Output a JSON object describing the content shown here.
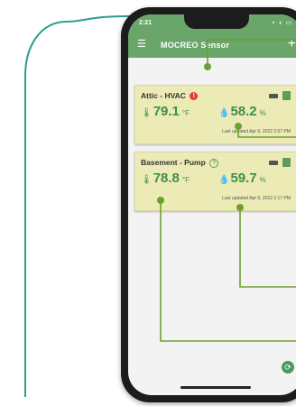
{
  "status_bar": {
    "time": "2:21",
    "system_icons": "signal wifi battery"
  },
  "app_bar": {
    "menu_icon": "menu-icon",
    "title": "MOCREO Sensor",
    "add_icon": "plus-icon"
  },
  "sensors": [
    {
      "name": "Attic - HVAC",
      "status_icon": "alert-icon",
      "status_glyph": "!",
      "temperature": "79.1",
      "temperature_unit": "°F",
      "humidity": "58.2",
      "humidity_unit": "%",
      "last_updated": "Last updated Apr 9, 2022 2:07 PM"
    },
    {
      "name": "Basement - Pump",
      "status_icon": "help-icon",
      "status_glyph": "?",
      "temperature": "78.8",
      "temperature_unit": "°F",
      "humidity": "59.7",
      "humidity_unit": "%",
      "last_updated": "Last updated Apr 9, 2022 2:17 PM"
    }
  ],
  "colors": {
    "app_bar": "#6aa56a",
    "card_bg": "#ecebb6",
    "value_text": "#3e8e4a",
    "alert": "#e53935",
    "callout_line": "#6f9f2f",
    "outline": "#2a9f8c"
  }
}
